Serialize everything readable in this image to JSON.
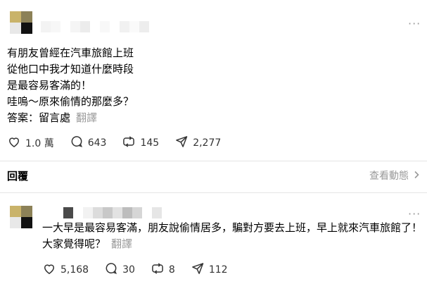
{
  "post": {
    "lines": [
      "有朋友曾經在汽車旅館上班",
      "從他口中我才知道什麼時段",
      "是最容易客滿的！",
      "哇嗚～原來偷情的那麼多？"
    ],
    "answer_label": "答案：留言處",
    "translate_label": "翻譯",
    "stats": {
      "likes": "1.0 萬",
      "comments": "643",
      "reposts": "145",
      "shares": "2,277"
    },
    "more_label": "···"
  },
  "replies_section": {
    "title": "回覆",
    "view_activity": "查看動態"
  },
  "reply": {
    "lines": [
      "一大早是最容易客滿，朋友說偷情居多，騙對方要去上班，早上就來汽車旅館了！",
      "大家覺得呢？"
    ],
    "translate_label": "翻譯",
    "stats": {
      "likes": "5,168",
      "comments": "30",
      "reposts": "8",
      "shares": "112"
    },
    "more_label": "···"
  },
  "colors": {
    "avatar": [
      "#c9b36a",
      "#8c8157",
      "#e8e8e8",
      "#111111"
    ],
    "muted": "#999999",
    "divider": "#e5e5e5"
  },
  "icons": [
    "heart-icon",
    "comment-icon",
    "repost-icon",
    "share-icon",
    "chevron-right-icon",
    "more-icon"
  ]
}
